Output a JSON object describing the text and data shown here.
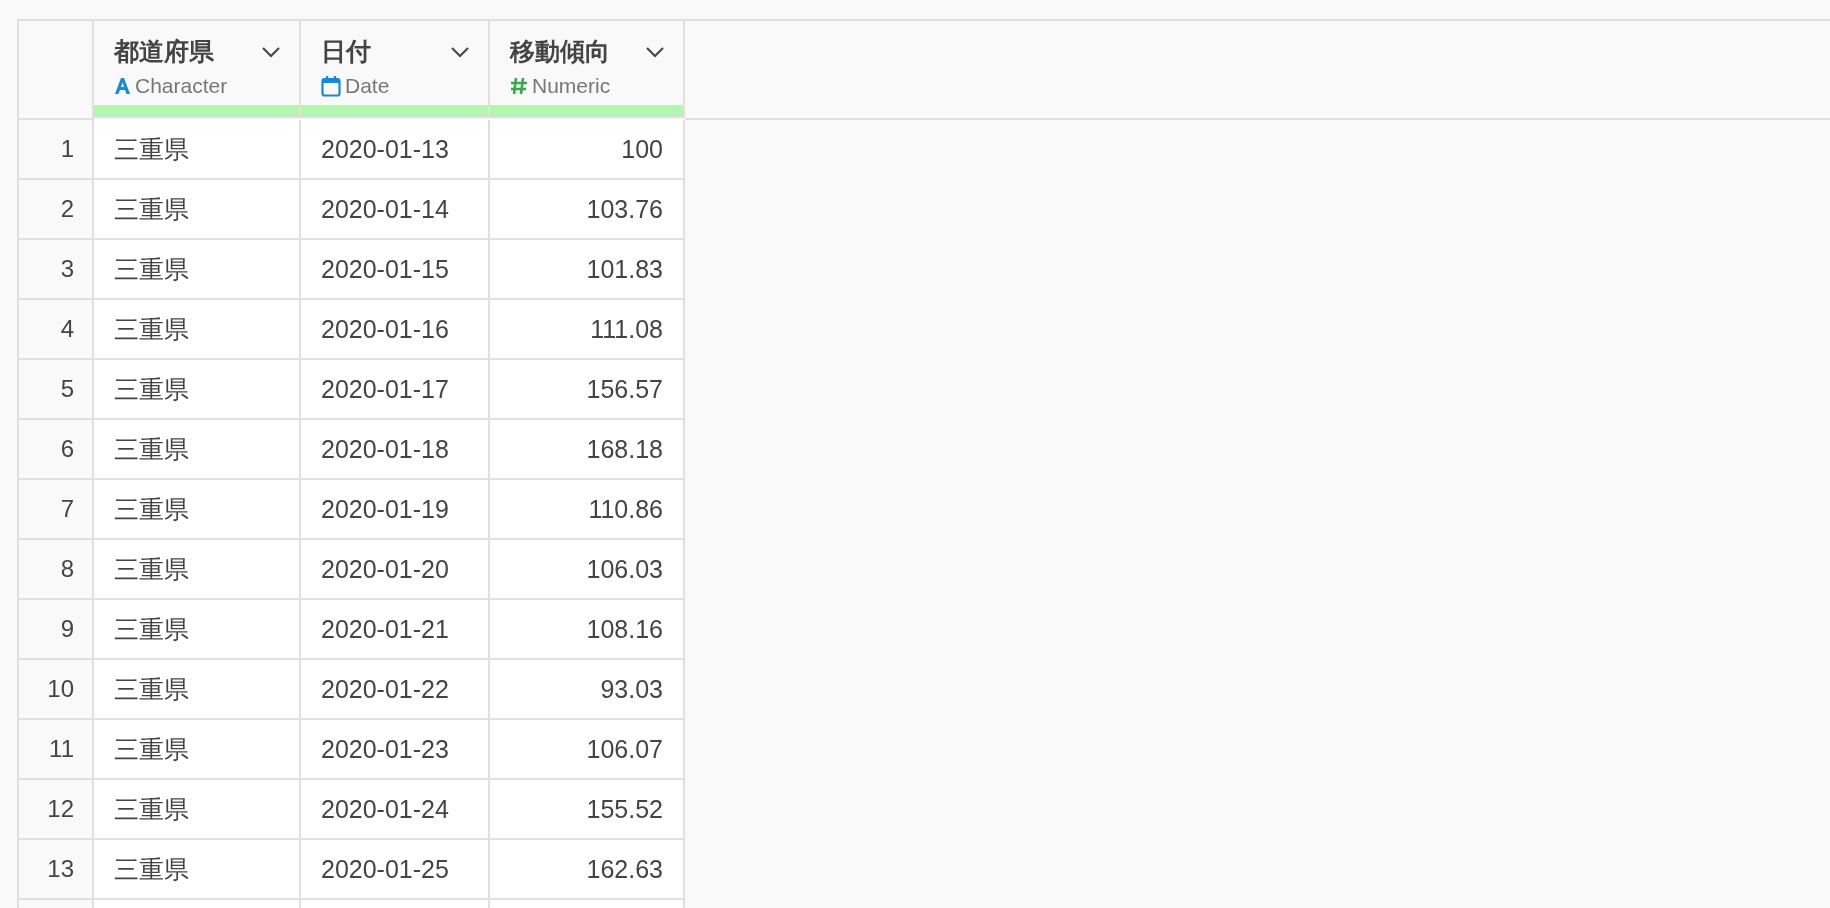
{
  "table": {
    "columns": [
      {
        "name": "都道府県",
        "type_label": "Character",
        "kind": "character"
      },
      {
        "name": "日付",
        "type_label": "Date",
        "kind": "date"
      },
      {
        "name": "移動傾向",
        "type_label": "Numeric",
        "kind": "numeric"
      }
    ],
    "rows": [
      {
        "index": "1",
        "cells": [
          "三重県",
          "2020-01-13",
          "100"
        ]
      },
      {
        "index": "2",
        "cells": [
          "三重県",
          "2020-01-14",
          "103.76"
        ]
      },
      {
        "index": "3",
        "cells": [
          "三重県",
          "2020-01-15",
          "101.83"
        ]
      },
      {
        "index": "4",
        "cells": [
          "三重県",
          "2020-01-16",
          "111.08"
        ]
      },
      {
        "index": "5",
        "cells": [
          "三重県",
          "2020-01-17",
          "156.57"
        ]
      },
      {
        "index": "6",
        "cells": [
          "三重県",
          "2020-01-18",
          "168.18"
        ]
      },
      {
        "index": "7",
        "cells": [
          "三重県",
          "2020-01-19",
          "110.86"
        ]
      },
      {
        "index": "8",
        "cells": [
          "三重県",
          "2020-01-20",
          "106.03"
        ]
      },
      {
        "index": "9",
        "cells": [
          "三重県",
          "2020-01-21",
          "108.16"
        ]
      },
      {
        "index": "10",
        "cells": [
          "三重県",
          "2020-01-22",
          "93.03"
        ]
      },
      {
        "index": "11",
        "cells": [
          "三重県",
          "2020-01-23",
          "106.07"
        ]
      },
      {
        "index": "12",
        "cells": [
          "三重県",
          "2020-01-24",
          "155.52"
        ]
      },
      {
        "index": "13",
        "cells": [
          "三重県",
          "2020-01-25",
          "162.63"
        ]
      }
    ]
  }
}
